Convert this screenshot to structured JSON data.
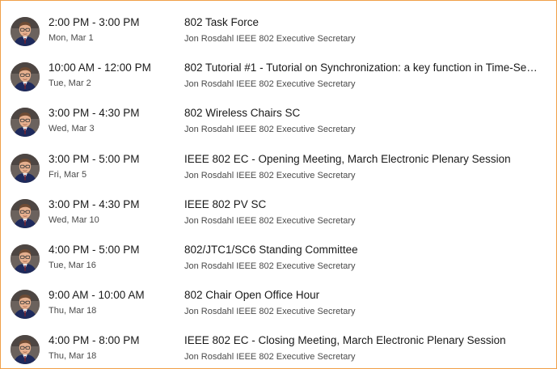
{
  "meetings": [
    {
      "time": "2:00 PM - 3:00 PM",
      "date": "Mon, Mar 1",
      "title": "802 Task Force",
      "organizer": "Jon Rosdahl IEEE 802 Executive Secretary"
    },
    {
      "time": "10:00 AM - 12:00 PM",
      "date": "Tue, Mar 2",
      "title": "802 Tutorial #1 - Tutorial on Synchronization: a key function in Time-Sen...",
      "organizer": "Jon Rosdahl IEEE 802 Executive Secretary"
    },
    {
      "time": "3:00 PM - 4:30 PM",
      "date": "Wed, Mar 3",
      "title": "802 Wireless Chairs SC",
      "organizer": "Jon Rosdahl IEEE 802 Executive Secretary"
    },
    {
      "time": "3:00 PM - 5:00 PM",
      "date": "Fri, Mar 5",
      "title": "IEEE 802 EC - Opening Meeting, March Electronic Plenary Session",
      "organizer": "Jon Rosdahl IEEE 802 Executive Secretary"
    },
    {
      "time": "3:00 PM - 4:30 PM",
      "date": "Wed, Mar 10",
      "title": "IEEE 802 PV SC",
      "organizer": "Jon Rosdahl IEEE 802 Executive Secretary"
    },
    {
      "time": "4:00 PM - 5:00 PM",
      "date": "Tue, Mar 16",
      "title": "802/JTC1/SC6 Standing Committee",
      "organizer": "Jon Rosdahl IEEE 802 Executive Secretary"
    },
    {
      "time": "9:00 AM - 10:00 AM",
      "date": "Thu, Mar 18",
      "title": "802 Chair Open Office Hour",
      "organizer": "Jon Rosdahl IEEE 802 Executive Secretary"
    },
    {
      "time": "4:00 PM - 8:00 PM",
      "date": "Thu, Mar 18",
      "title": "IEEE 802 EC - Closing Meeting, March Electronic Plenary Session",
      "organizer": "Jon Rosdahl IEEE 802 Executive Secretary"
    }
  ],
  "colors": {
    "frame_border": "#f0a048",
    "primary_text": "#1a1a1a",
    "secondary_text": "#4a4a4a"
  },
  "icons": {
    "avatar": "organizer-avatar-photo"
  }
}
